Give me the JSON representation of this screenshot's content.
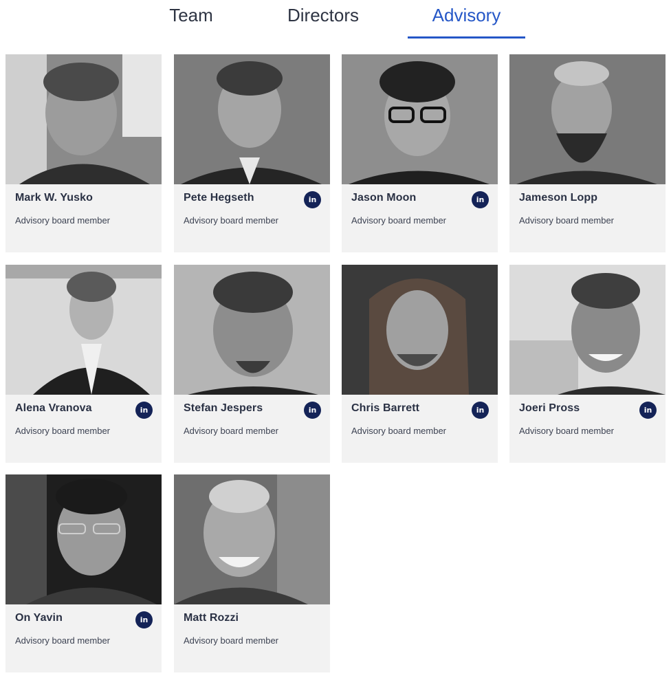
{
  "tabs": [
    {
      "label": "Team"
    },
    {
      "label": "Directors"
    },
    {
      "label": "Advisory",
      "active": true
    }
  ],
  "accent_color": "#2557c7",
  "linkedin_color": "#142357",
  "linkedin_icon_text": "in",
  "members": [
    {
      "name": "Mark W. Yusko",
      "role": "Advisory board member",
      "linkedin": false,
      "photo": "portrait-photo"
    },
    {
      "name": "Pete Hegseth",
      "role": "Advisory board member",
      "linkedin": true,
      "photo": "portrait-photo"
    },
    {
      "name": "Jason Moon",
      "role": "Advisory board member",
      "linkedin": true,
      "photo": "portrait-photo"
    },
    {
      "name": "Jameson Lopp",
      "role": "Advisory board member",
      "linkedin": false,
      "photo": "portrait-photo"
    },
    {
      "name": "Alena Vranova",
      "role": "Advisory board member",
      "linkedin": true,
      "photo": "portrait-photo"
    },
    {
      "name": "Stefan Jespers",
      "role": "Advisory board member",
      "linkedin": true,
      "photo": "portrait-photo"
    },
    {
      "name": "Chris Barrett",
      "role": "Advisory board member",
      "linkedin": true,
      "photo": "portrait-photo"
    },
    {
      "name": "Joeri Pross",
      "role": "Advisory board member",
      "linkedin": true,
      "photo": "portrait-photo"
    },
    {
      "name": "On Yavin",
      "role": "Advisory board member",
      "linkedin": true,
      "photo": "portrait-photo"
    },
    {
      "name": "Matt Rozzi",
      "role": "Advisory board member",
      "linkedin": false,
      "photo": "portrait-photo"
    }
  ]
}
